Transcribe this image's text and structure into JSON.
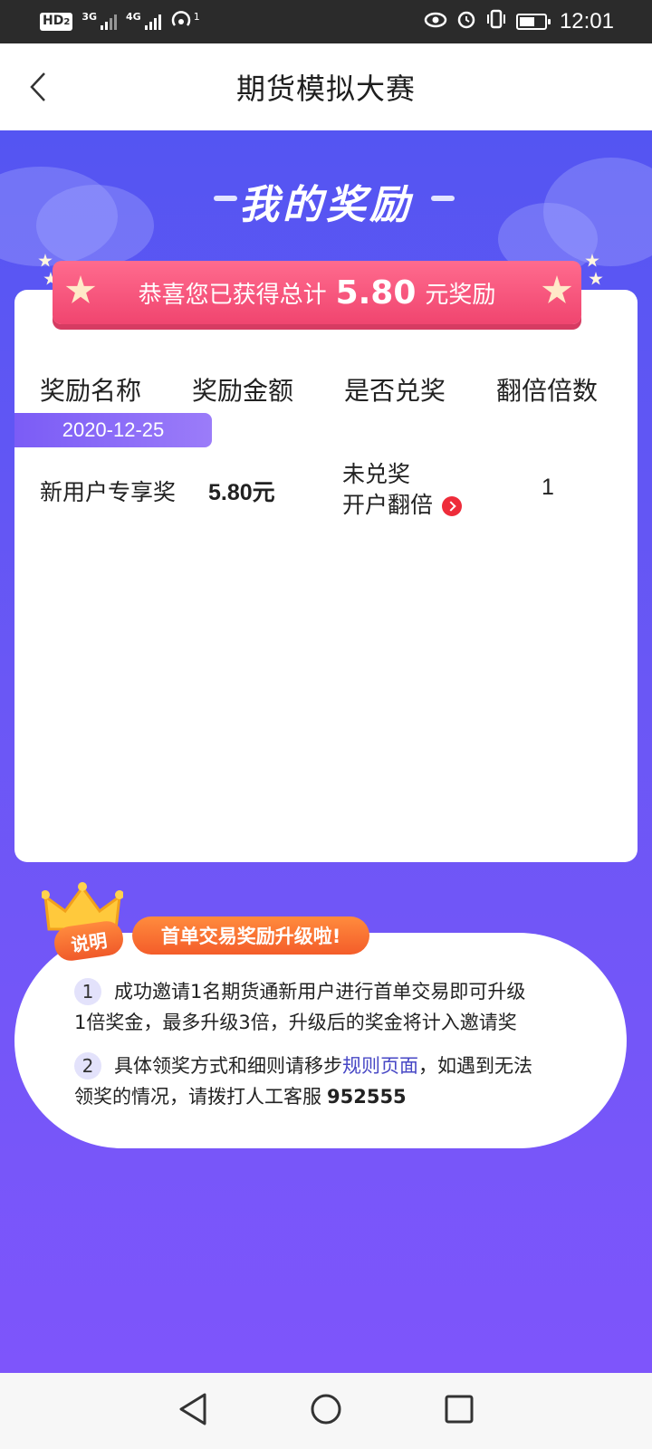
{
  "status_bar": {
    "hd": "HD",
    "hd_sub": "2",
    "net1": "3G",
    "net2": "4G",
    "wifi_sub": "1",
    "time": "12:01"
  },
  "header": {
    "title": "期货模拟大赛"
  },
  "hero": {
    "title": "我的奖励"
  },
  "banner": {
    "prefix": "恭喜您已获得总计",
    "amount": "5.80",
    "suffix": "元奖励"
  },
  "table": {
    "headers": [
      "奖励名称",
      "奖励金额",
      "是否兑奖",
      "翻倍倍数"
    ],
    "groups": [
      {
        "date": "2020-12-25",
        "rows": [
          {
            "name": "新用户专享奖",
            "amount": "5.80元",
            "status": "未兑奖",
            "action": "开户翻倍",
            "multiplier": "1"
          }
        ]
      }
    ]
  },
  "info": {
    "badge": "说明",
    "promo": "首单交易奖励升级啦!",
    "rules": [
      {
        "num": "1",
        "line1": "成功邀请1名期货通新用户进行首单交易即可升级",
        "line2": "1倍奖金，最多升级3倍，升级后的奖金将计入邀请奖"
      },
      {
        "num": "2",
        "line1_a": "具体领奖方式和细则请移步",
        "link": "规则页面",
        "line1_b": "，如遇到无法",
        "line2_a": "领奖的情况，请拨打人工客服",
        "phone": "952555"
      }
    ]
  },
  "colors": {
    "primary": "#5455f2",
    "banner": "#f0456f",
    "accent": "#f45d2a"
  }
}
